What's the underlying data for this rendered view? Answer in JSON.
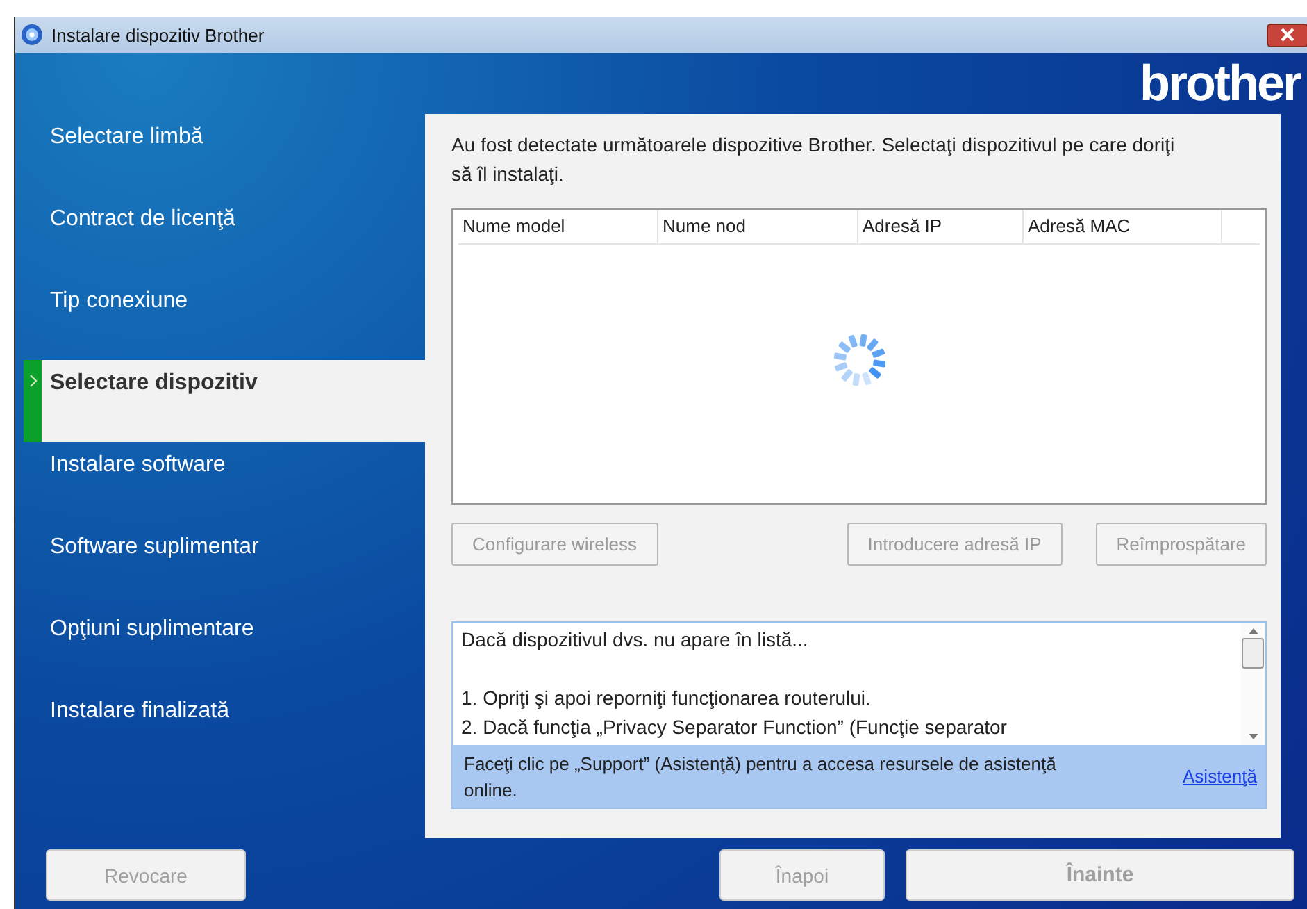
{
  "window": {
    "title": "Instalare dispozitiv Brother",
    "logo": "brother"
  },
  "sidebar": {
    "items": [
      {
        "label": "Selectare limbă",
        "selected": false
      },
      {
        "label": "Contract de licenţă",
        "selected": false
      },
      {
        "label": "Tip conexiune",
        "selected": false
      },
      {
        "label": "Selectare dispozitiv",
        "selected": true
      },
      {
        "label": "Instalare software",
        "selected": false
      },
      {
        "label": "Software suplimentar",
        "selected": false
      },
      {
        "label": "Opţiuni suplimentare",
        "selected": false
      },
      {
        "label": "Instalare finalizată",
        "selected": false
      }
    ]
  },
  "content": {
    "intro": "Au fost detectate următoarele dispozitive Brother. Selectaţi dispozitivul pe care doriţi să îl instalaţi.",
    "table": {
      "columns": [
        "Nume model",
        "Nume nod",
        "Adresă IP",
        "Adresă MAC"
      ],
      "loading": true
    },
    "buttons": [
      {
        "label": "Configurare wireless",
        "disabled": true
      },
      {
        "label": "Introducere adresă IP",
        "disabled": true
      },
      {
        "label": "Reîmprospătare",
        "disabled": true
      }
    ],
    "help_text": {
      "heading": "Dacă dispozitivul dvs. nu apare în listă...",
      "steps": [
        "1. Opriţi şi apoi reporniţi funcţionarea routerului.",
        "2. Dacă funcţia „Privacy Separator Function” (Funcţie separator"
      ]
    },
    "support": {
      "text": "Faceţi clic pe „Support” (Asistenţă) pentru a accesa resursele de asistenţă online.",
      "link": "Asistenţă"
    }
  },
  "footer": {
    "buttons": [
      {
        "label": "Revocare",
        "disabled": true
      },
      {
        "label": "Înapoi",
        "disabled": true
      },
      {
        "label": "Înainte",
        "disabled": true
      }
    ]
  }
}
